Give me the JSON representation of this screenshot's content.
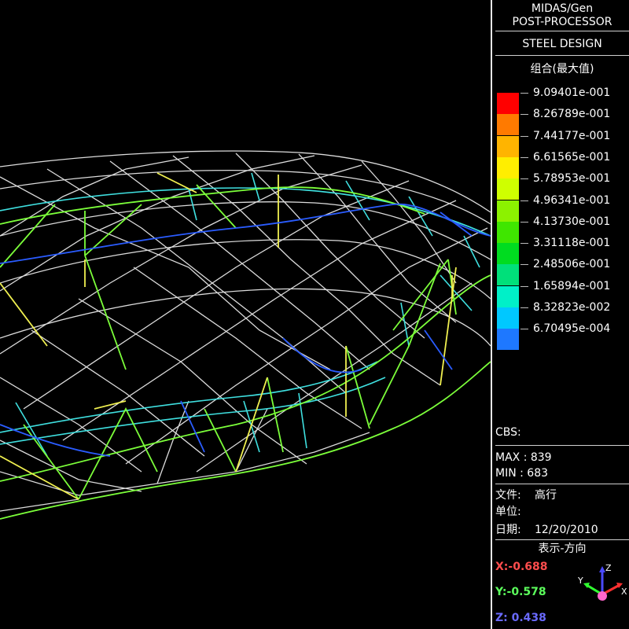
{
  "panel": {
    "app_name": "MIDAS/Gen",
    "app_module": "POST-PROCESSOR",
    "design_type": "STEEL DESIGN",
    "result_type": "组合(最大值)",
    "legend": [
      {
        "value": "9.09401e-001",
        "color": "#ff0000"
      },
      {
        "value": "8.26789e-001",
        "color": "#ff7a00"
      },
      {
        "value": "7.44177e-001",
        "color": "#ffb400"
      },
      {
        "value": "6.61565e-001",
        "color": "#ffee00"
      },
      {
        "value": "5.78953e-001",
        "color": "#cfff00"
      },
      {
        "value": "4.96341e-001",
        "color": "#8cf200"
      },
      {
        "value": "4.13730e-001",
        "color": "#3fe600"
      },
      {
        "value": "3.31118e-001",
        "color": "#00dc20"
      },
      {
        "value": "2.48506e-001",
        "color": "#00e07a"
      },
      {
        "value": "1.65894e-001",
        "color": "#00f0c8"
      },
      {
        "value": "8.32823e-002",
        "color": "#00c8ff"
      },
      {
        "value": "6.70495e-004",
        "color": "#1e78ff"
      }
    ],
    "cbs_label": "CBS:",
    "max_label": "MAX : 839",
    "min_label": "MIN : 683",
    "file_label": "文件:",
    "file_value": "高行",
    "unit_label": "单位:",
    "date_label": "日期:",
    "date_value": "12/20/2010",
    "view_dir_label": "表示-方向",
    "axis_x": "X:-0.688",
    "axis_y": "Y:-0.578",
    "axis_z": "Z: 0.438",
    "colors": {
      "x": "#ff4040",
      "y": "#40ff40",
      "z": "#4a4aff"
    }
  },
  "triad": {
    "x": "X",
    "y": "Y",
    "z": "Z"
  }
}
